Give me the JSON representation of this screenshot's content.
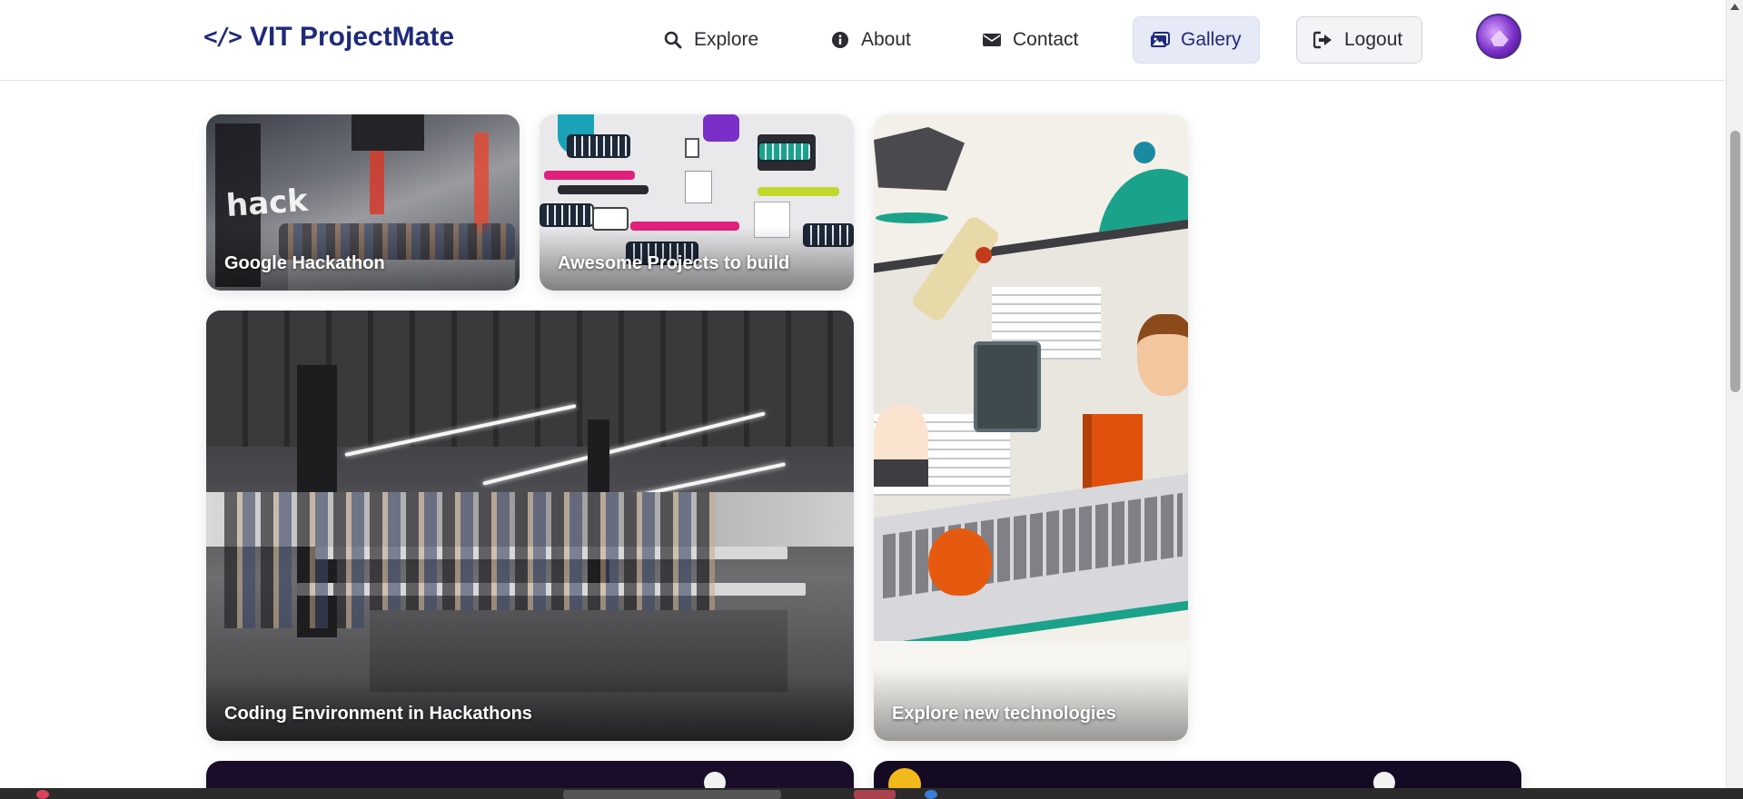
{
  "navbar": {
    "brand_icon": "</>",
    "brand": "VIT ProjectMate",
    "items": [
      {
        "label": "Explore",
        "icon": "search-icon"
      },
      {
        "label": "About",
        "icon": "info-icon"
      },
      {
        "label": "Contact",
        "icon": "envelope-icon"
      },
      {
        "label": "Gallery",
        "icon": "images-icon",
        "active": true
      },
      {
        "label": "Logout",
        "icon": "logout-icon"
      }
    ],
    "avatar": "avatar"
  },
  "gallery": {
    "cards": [
      {
        "title": "Google Hackathon"
      },
      {
        "title": "Awesome Projects to build"
      },
      {
        "title": "Explore new technologies"
      },
      {
        "title": "Coding Environment in Hackathons"
      }
    ]
  },
  "colors": {
    "brand": "#1f2a7a",
    "active_nav_bg": "#e6e9f6",
    "accent_teal": "#1aa38a"
  }
}
